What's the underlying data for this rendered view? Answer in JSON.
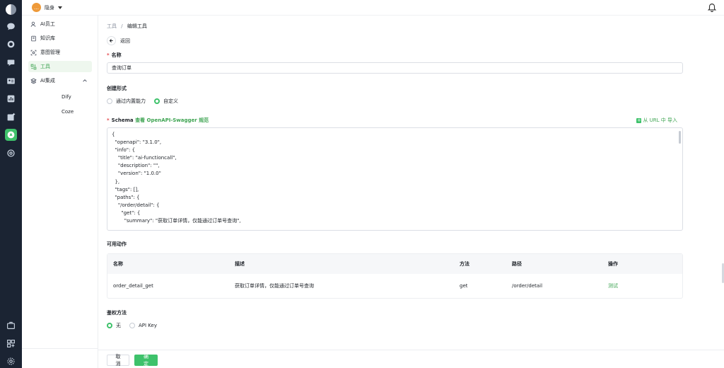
{
  "workspace": {
    "name": "隐身",
    "avatar_glyph": "…"
  },
  "sidebar": {
    "items": [
      {
        "label": "AI员工",
        "icon": "user-icon"
      },
      {
        "label": "知识库",
        "icon": "book-icon"
      },
      {
        "label": "意图管理",
        "icon": "target-scan-icon"
      },
      {
        "label": "工具",
        "icon": "tools-icon"
      },
      {
        "label": "AI集成",
        "icon": "layers-icon"
      }
    ],
    "subitems": [
      "Dify",
      "Coze"
    ]
  },
  "breadcrumb": {
    "parent": "工具",
    "separator": "/",
    "current": "编辑工具"
  },
  "back_label": "返回",
  "form": {
    "name_label": "名称",
    "name_value": "查询订单",
    "create_mode_label": "创建形式",
    "create_mode_options": [
      "通过内置能力",
      "自定义"
    ],
    "create_mode_selected": "自定义",
    "schema_label": "Schema",
    "schema_link": "查看 OpenAPI-Swagger 规范",
    "import_label": "从 URL 中 导入",
    "schema_code": "{\n  \"openapi\": \"3.1.0\",\n  \"info\": {\n    \"title\": \"ai-functioncall\",\n    \"description\": \"\",\n    \"version\": \"1.0.0\"\n  },\n  \"tags\": [],\n  \"paths\": {\n    \"/order/detail\": {\n      \"get\": {\n        \"summary\": \"获取订单详情，仅能通过订单号查询\",",
    "actions_label": "可用动作",
    "actions_table": {
      "headers": [
        "名称",
        "描述",
        "方法",
        "路径",
        "操作"
      ],
      "rows": [
        {
          "name": "order_detail_get",
          "description": "获取订单详情，仅能通过订单号查询",
          "method": "get",
          "path": "/order/detail",
          "action": "测试"
        }
      ]
    },
    "auth_label": "鉴权方法",
    "auth_options": [
      "无",
      "API Key"
    ],
    "auth_selected": "无"
  },
  "footer": {
    "cancel_label": "取 消",
    "ok_label": "确 定"
  },
  "colors": {
    "accent": "#3ec26b",
    "rail_bg": "#1b2433",
    "required": "#e5484d"
  }
}
